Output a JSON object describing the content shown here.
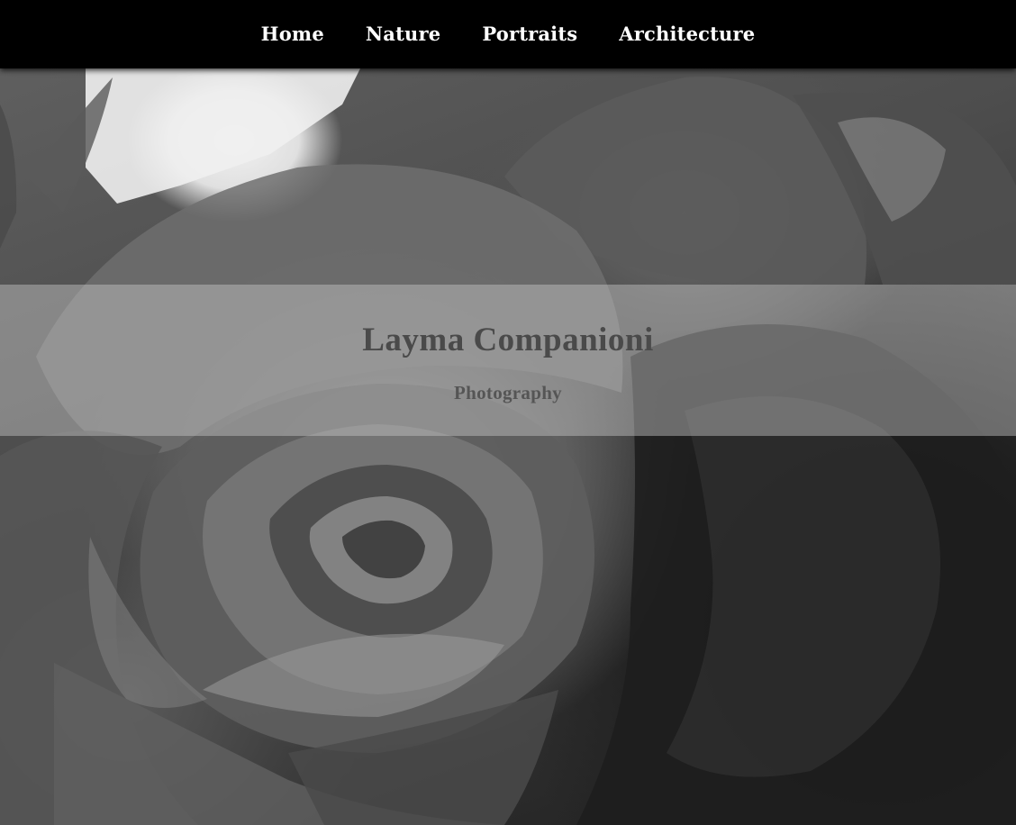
{
  "nav": {
    "items": [
      {
        "label": "Home"
      },
      {
        "label": "Nature"
      },
      {
        "label": "Portraits"
      },
      {
        "label": "Architecture"
      }
    ]
  },
  "hero": {
    "image": "grayscale-rose-photo",
    "title": "Layma Companioni",
    "subtitle": "Photography"
  },
  "colors": {
    "nav_background": "#000000",
    "nav_text": "#ffffff",
    "title_text": "#4a4a4a",
    "band_overlay": "#c8c8c8"
  }
}
